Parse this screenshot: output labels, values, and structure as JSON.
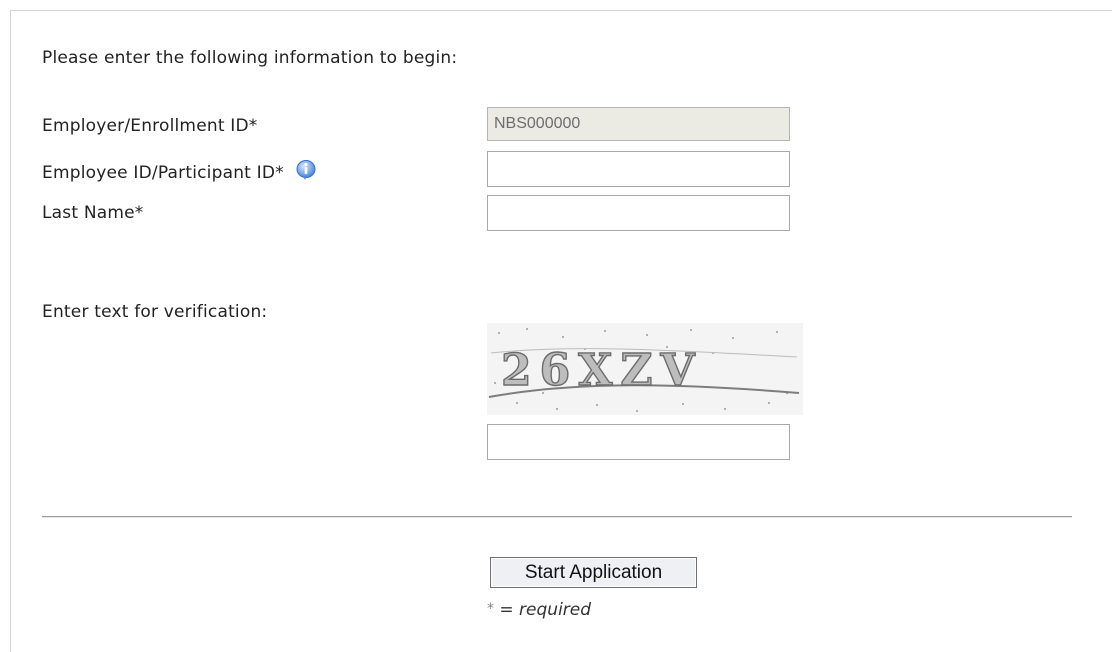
{
  "form": {
    "intro": "Please enter the following information to begin:",
    "employer_label": "Employer/Enrollment ID*",
    "employer_value": "NBS000000",
    "employee_label": "Employee ID/Participant ID*",
    "employee_value": "",
    "lastname_label": "Last Name*",
    "lastname_value": "",
    "verification_label": "Enter text for verification:",
    "captcha_text": "26XZV",
    "captcha_value": "",
    "submit_label": "Start Application",
    "required_star": "*",
    "required_note": " = required"
  },
  "icons": {
    "info": "info-icon"
  },
  "colors": {
    "disabled_field_bg": "#ebebe4",
    "info_icon_blue": "#2f6fd3"
  }
}
